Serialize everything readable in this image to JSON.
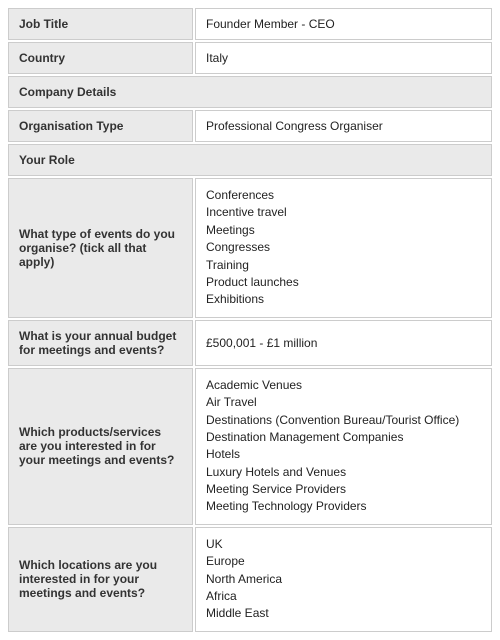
{
  "rows": {
    "job_title": {
      "label": "Job Title",
      "value": "Founder Member - CEO"
    },
    "country": {
      "label": "Country",
      "value": "Italy"
    },
    "company_details_header": "Company Details",
    "org_type": {
      "label": "Organisation Type",
      "value": "Professional Congress Organiser"
    },
    "your_role_header": "Your Role",
    "event_types": {
      "label": "What type of events do you organise? (tick all that apply)",
      "values": [
        "Conferences",
        "Incentive travel",
        "Meetings",
        "Congresses",
        "Training",
        "Product launches",
        "Exhibitions"
      ]
    },
    "budget": {
      "label": "What is your annual budget for meetings and events?",
      "value": "£500,001 - £1 million"
    },
    "products_services": {
      "label": "Which products/services are you interested in for your meetings and events?",
      "values": [
        "Academic Venues",
        "Air Travel",
        "Destinations (Convention Bureau/Tourist Office)",
        "Destination Management Companies",
        "Hotels",
        "Luxury Hotels and Venues",
        "Meeting Service Providers",
        "Meeting Technology Providers"
      ]
    },
    "locations": {
      "label": "Which locations are you interested in for your meetings and events?",
      "values": [
        "UK",
        "Europe",
        "North America",
        "Africa",
        "Middle East"
      ]
    }
  }
}
